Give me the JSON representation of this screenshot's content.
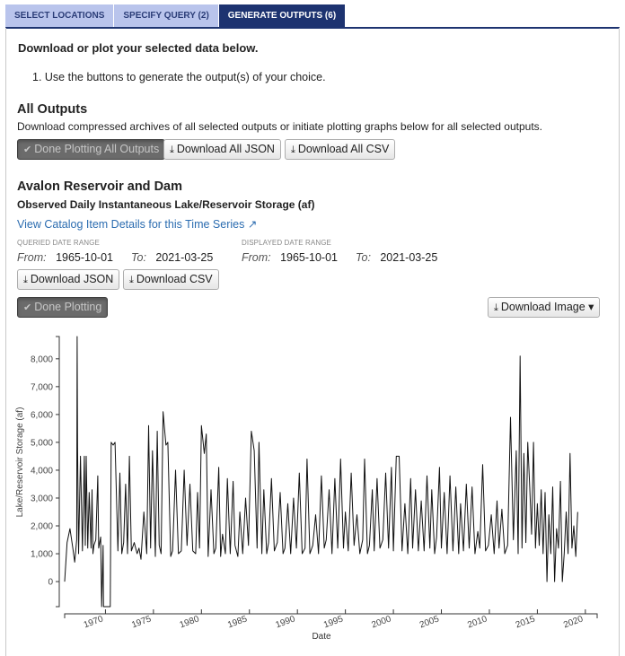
{
  "tabs": [
    {
      "label": "SELECT LOCATIONS",
      "active": false
    },
    {
      "label": "SPECIFY QUERY (2)",
      "active": false
    },
    {
      "label": "GENERATE OUTPUTS (6)",
      "active": true
    }
  ],
  "intro": "Download or plot your selected data below.",
  "step": "1. Use the buttons to generate the output(s) of your choice.",
  "all_outputs": {
    "title": "All Outputs",
    "description": "Download compressed archives of all selected outputs or initiate plotting graphs below for all selected outputs.",
    "done_plotting_label": "Done Plotting All Outputs",
    "download_json_label": "Download All JSON",
    "download_csv_label": "Download All CSV"
  },
  "series": {
    "site": "Avalon Reservoir and Dam",
    "name": "Observed Daily Instantaneous Lake/Reservoir Storage (af)",
    "catalog_link": "View Catalog Item Details for this Time Series",
    "queried_label": "Queried Date Range",
    "displayed_label": "Displayed Date Range",
    "from_label": "From:",
    "to_label": "To:",
    "queried_from": "1965-10-01",
    "queried_to": "2021-03-25",
    "displayed_from": "1965-10-01",
    "displayed_to": "2021-03-25",
    "download_json_label": "Download JSON",
    "download_csv_label": "Download CSV",
    "done_plotting_label": "Done Plotting",
    "download_image_label": "Download Image"
  },
  "icons": {
    "check": "✔",
    "download": "⤓",
    "external": "↗",
    "caret": "▾"
  },
  "chart_data": {
    "type": "line",
    "title": "",
    "xlabel": "Date",
    "ylabel": "Lake/Reservoir Storage (af)",
    "ylim": [
      -900,
      8800
    ],
    "xlim": [
      1965.75,
      2021.23
    ],
    "yticks": [
      0,
      1000,
      2000,
      3000,
      4000,
      5000,
      6000,
      7000,
      8000
    ],
    "ytick_labels": [
      "0",
      "1,000",
      "2,000",
      "3,000",
      "4,000",
      "5,000",
      "6,000",
      "7,000",
      "8,000"
    ],
    "xticks": [
      1970,
      1975,
      1980,
      1985,
      1990,
      1995,
      2000,
      2005,
      2010,
      2015,
      2020
    ],
    "xtick_labels": [
      "1970",
      "1975",
      "1980",
      "1985",
      "1990",
      "1995",
      "2000",
      "2005",
      "2010",
      "2015",
      "2020"
    ],
    "grid": false,
    "legend": "none",
    "line_color": "#111111",
    "series": [
      {
        "name": "Observed Daily Instantaneous Lake/Reservoir Storage (af)",
        "x": [
          1965.75,
          1966.0,
          1966.3,
          1966.6,
          1966.8,
          1967.0,
          1967.05,
          1967.1,
          1967.2,
          1967.4,
          1967.6,
          1967.8,
          1967.9,
          1968.0,
          1968.15,
          1968.3,
          1968.5,
          1968.6,
          1968.7,
          1968.8,
          1969.0,
          1969.2,
          1969.3,
          1969.5,
          1969.6,
          1969.75,
          1969.8,
          1970.0,
          1970.3,
          1970.5,
          1970.6,
          1970.8,
          1971.0,
          1971.3,
          1971.5,
          1971.7,
          1971.9,
          1972.1,
          1972.3,
          1972.5,
          1972.7,
          1973.0,
          1973.3,
          1973.5,
          1973.7,
          1974.0,
          1974.3,
          1974.5,
          1974.7,
          1974.9,
          1975.2,
          1975.4,
          1975.6,
          1975.8,
          1976.0,
          1976.3,
          1976.5,
          1976.8,
          1977.0,
          1977.3,
          1977.6,
          1977.9,
          1978.2,
          1978.5,
          1978.8,
          1979.1,
          1979.4,
          1979.6,
          1979.8,
          1980.0,
          1980.3,
          1980.5,
          1980.7,
          1981.0,
          1981.3,
          1981.5,
          1981.8,
          1982.0,
          1982.2,
          1982.5,
          1982.7,
          1983.0,
          1983.3,
          1983.5,
          1983.8,
          1984.0,
          1984.3,
          1984.6,
          1984.9,
          1985.2,
          1985.5,
          1985.8,
          1986.0,
          1986.3,
          1986.5,
          1986.8,
          1987.0,
          1987.3,
          1987.6,
          1987.9,
          1988.2,
          1988.5,
          1988.7,
          1989.0,
          1989.3,
          1989.6,
          1989.9,
          1990.2,
          1990.5,
          1990.8,
          1991.0,
          1991.3,
          1991.6,
          1991.9,
          1992.2,
          1992.5,
          1992.8,
          1993.0,
          1993.3,
          1993.6,
          1993.9,
          1994.2,
          1994.5,
          1994.8,
          1995.0,
          1995.3,
          1995.6,
          1995.9,
          1996.2,
          1996.5,
          1996.8,
          1997.0,
          1997.3,
          1997.5,
          1997.8,
          1998.0,
          1998.3,
          1998.6,
          1998.9,
          1999.2,
          1999.5,
          1999.8,
          2000.0,
          2000.3,
          2000.6,
          2000.9,
          2001.2,
          2001.5,
          2001.8,
          2002.0,
          2002.3,
          2002.6,
          2002.9,
          2003.2,
          2003.5,
          2003.8,
          2004.0,
          2004.3,
          2004.5,
          2004.8,
          2005.0,
          2005.3,
          2005.6,
          2005.9,
          2006.2,
          2006.5,
          2006.8,
          2007.0,
          2007.3,
          2007.6,
          2007.9,
          2008.2,
          2008.5,
          2008.8,
          2009.0,
          2009.3,
          2009.6,
          2009.9,
          2010.2,
          2010.5,
          2010.8,
          2011.0,
          2011.3,
          2011.6,
          2011.9,
          2012.2,
          2012.5,
          2012.8,
          2013.0,
          2013.2,
          2013.4,
          2013.6,
          2013.8,
          2014.0,
          2014.2,
          2014.4,
          2014.6,
          2014.8,
          2015.0,
          2015.2,
          2015.4,
          2015.6,
          2015.8,
          2016.0,
          2016.2,
          2016.4,
          2016.6,
          2016.8,
          2017.0,
          2017.2,
          2017.4,
          2017.6,
          2017.8,
          2018.0,
          2018.2,
          2018.4,
          2018.6,
          2018.8,
          2019.0,
          2019.2,
          2019.4,
          2019.6,
          2019.8,
          2020.0,
          2020.2,
          2020.4,
          2020.6,
          2020.8,
          2021.0,
          2021.23
        ],
        "y": [
          0,
          1400,
          1900,
          1200,
          700,
          1500,
          8800,
          4800,
          1000,
          4500,
          1100,
          4500,
          1300,
          4500,
          1200,
          3200,
          1200,
          3300,
          1000,
          1300,
          1500,
          3800,
          1200,
          1600,
          -900,
          1300,
          -900,
          -900,
          -900,
          -900,
          5000,
          4900,
          5000,
          1100,
          3900,
          1000,
          1400,
          3500,
          1000,
          4500,
          1100,
          1400,
          1000,
          1200,
          800,
          2500,
          1000,
          5600,
          1200,
          4700,
          900,
          5400,
          1300,
          1000,
          6100,
          4900,
          5000,
          900,
          1100,
          4000,
          1000,
          1100,
          4000,
          1300,
          3500,
          1100,
          1000,
          3200,
          1200,
          5600,
          4600,
          5300,
          900,
          3300,
          1000,
          1200,
          4100,
          900,
          1700,
          1000,
          3700,
          1000,
          3600,
          1300,
          900,
          2500,
          1000,
          3000,
          1300,
          5400,
          4700,
          1200,
          5000,
          1000,
          3300,
          1000,
          1400,
          3700,
          1100,
          1400,
          3200,
          1000,
          1200,
          2800,
          1000,
          3000,
          1200,
          3900,
          1000,
          1200,
          4400,
          1000,
          1300,
          2400,
          1000,
          3800,
          1200,
          1500,
          3300,
          1000,
          3700,
          1200,
          4400,
          1200,
          2500,
          1100,
          3900,
          1300,
          2400,
          1000,
          1500,
          4400,
          1000,
          1300,
          3300,
          1100,
          3700,
          1200,
          1500,
          3900,
          1200,
          4100,
          1100,
          4500,
          4500,
          1100,
          2800,
          1000,
          3700,
          1200,
          3300,
          1100,
          2900,
          1100,
          3800,
          1200,
          3300,
          1000,
          1600,
          4100,
          1200,
          3200,
          1000,
          3800,
          1100,
          3400,
          1000,
          2800,
          1100,
          3500,
          1200,
          3400,
          1000,
          1800,
          1200,
          4200,
          1100,
          1300,
          2400,
          1000,
          2900,
          1200,
          2600,
          1000,
          1300,
          5900,
          1500,
          4700,
          1000,
          8100,
          1200,
          4600,
          1400,
          5000,
          3400,
          1700,
          5000,
          1200,
          2800,
          1300,
          3300,
          1000,
          3200,
          0,
          2400,
          1000,
          3400,
          0,
          1900,
          1200,
          3600,
          0,
          1000,
          2500,
          1000,
          4600,
          1200,
          2000,
          900,
          2500
        ]
      }
    ]
  }
}
